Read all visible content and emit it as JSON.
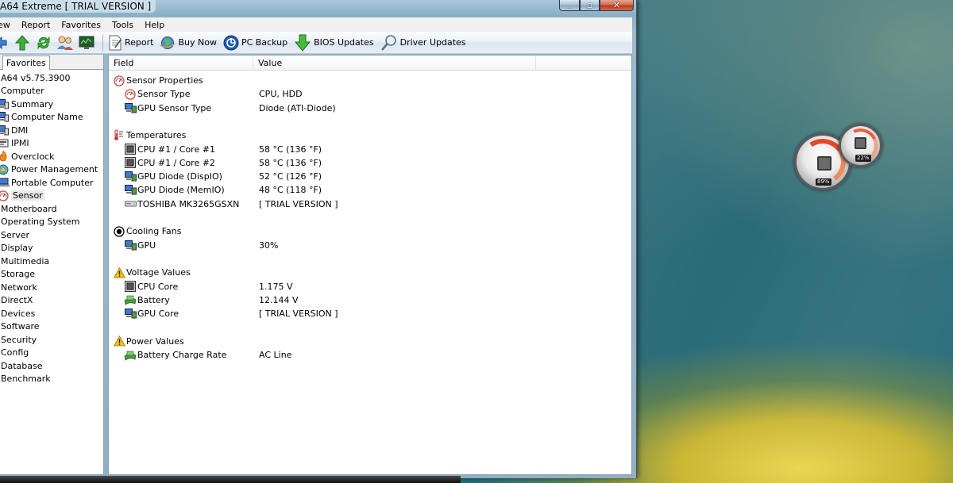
{
  "window": {
    "title": "A64 Extreme  [ TRIAL VERSION ]",
    "controls": {
      "minimize": "_",
      "maximize": "▫",
      "close": "✕"
    }
  },
  "menu": [
    "iew",
    "Report",
    "Favorites",
    "Tools",
    "Help"
  ],
  "toolbar": {
    "nav_icons": [
      "back-arrow-icon",
      "up-arrow-icon",
      "refresh-icon",
      "users-icon",
      "monitor-icon"
    ],
    "buttons": [
      {
        "label": "Report",
        "icon": "report-icon"
      },
      {
        "label": "Buy Now",
        "icon": "globe-icon"
      },
      {
        "label": "PC Backup",
        "icon": "backup-icon"
      },
      {
        "label": "BIOS Updates",
        "icon": "download-arrow-icon"
      },
      {
        "label": "Driver Updates",
        "icon": "magnifier-icon"
      }
    ]
  },
  "left_panel": {
    "tab": "Favorites",
    "tree": [
      {
        "label": "A64 v5.75.3900",
        "level": "root"
      },
      {
        "label": "Computer",
        "level": "root"
      },
      {
        "label": "Summary",
        "level": "child",
        "icon": "computer-icon"
      },
      {
        "label": "Computer Name",
        "level": "child",
        "icon": "computer-icon"
      },
      {
        "label": "DMI",
        "level": "child",
        "icon": "computer-icon"
      },
      {
        "label": "IPMI",
        "level": "child",
        "icon": "ipmi-icon"
      },
      {
        "label": "Overclock",
        "level": "child",
        "icon": "flame-icon"
      },
      {
        "label": "Power Management",
        "level": "child",
        "icon": "power-icon"
      },
      {
        "label": "Portable Computer",
        "level": "child",
        "icon": "laptop-icon"
      },
      {
        "label": "Sensor",
        "level": "child",
        "icon": "sensor-icon",
        "selected": true
      },
      {
        "label": "Motherboard",
        "level": "root"
      },
      {
        "label": "Operating System",
        "level": "root"
      },
      {
        "label": "Server",
        "level": "root"
      },
      {
        "label": "Display",
        "level": "root"
      },
      {
        "label": "Multimedia",
        "level": "root"
      },
      {
        "label": "Storage",
        "level": "root"
      },
      {
        "label": "Network",
        "level": "root"
      },
      {
        "label": "DirectX",
        "level": "root"
      },
      {
        "label": "Devices",
        "level": "root"
      },
      {
        "label": "Software",
        "level": "root"
      },
      {
        "label": "Security",
        "level": "root"
      },
      {
        "label": "Config",
        "level": "root"
      },
      {
        "label": "Database",
        "level": "root"
      },
      {
        "label": "Benchmark",
        "level": "root"
      }
    ]
  },
  "columns": {
    "field": "Field",
    "value": "Value"
  },
  "sections": [
    {
      "title": "Sensor Properties",
      "icon": "sensor-icon",
      "rows": [
        {
          "field": "Sensor Type",
          "value": "CPU, HDD",
          "icon": "sensor-icon"
        },
        {
          "field": "GPU Sensor Type",
          "value": "Diode  (ATI-Diode)",
          "icon": "gpu-icon"
        }
      ]
    },
    {
      "title": "Temperatures",
      "icon": "thermometer-icon",
      "rows": [
        {
          "field": "CPU #1 / Core #1",
          "value": "58 °C  (136 °F)",
          "icon": "cpu-icon"
        },
        {
          "field": "CPU #1 / Core #2",
          "value": "58 °C  (136 °F)",
          "icon": "cpu-icon"
        },
        {
          "field": "GPU Diode (DispIO)",
          "value": "52 °C  (126 °F)",
          "icon": "gpu-icon"
        },
        {
          "field": "GPU Diode (MemIO)",
          "value": "48 °C  (118 °F)",
          "icon": "gpu-icon"
        },
        {
          "field": "TOSHIBA MK3265GSXN",
          "value": "[ TRIAL VERSION ]",
          "icon": "hdd-icon"
        }
      ]
    },
    {
      "title": "Cooling Fans",
      "icon": "fan-icon",
      "rows": [
        {
          "field": "GPU",
          "value": "30%",
          "icon": "gpu-icon"
        }
      ]
    },
    {
      "title": "Voltage Values",
      "icon": "warning-icon",
      "rows": [
        {
          "field": "CPU Core",
          "value": "1.175 V",
          "icon": "cpu-icon"
        },
        {
          "field": "Battery",
          "value": "12.144 V",
          "icon": "battery-icon"
        },
        {
          "field": "GPU Core",
          "value": "[ TRIAL VERSION ]",
          "icon": "gpu-icon"
        }
      ]
    },
    {
      "title": "Power Values",
      "icon": "warning-icon",
      "rows": [
        {
          "field": "Battery Charge Rate",
          "value": "AC Line",
          "icon": "battery-icon"
        }
      ]
    }
  ],
  "gadgets": [
    {
      "name": "cpu-meter",
      "readout": "89%"
    },
    {
      "name": "ram-meter",
      "readout": "22%"
    }
  ]
}
